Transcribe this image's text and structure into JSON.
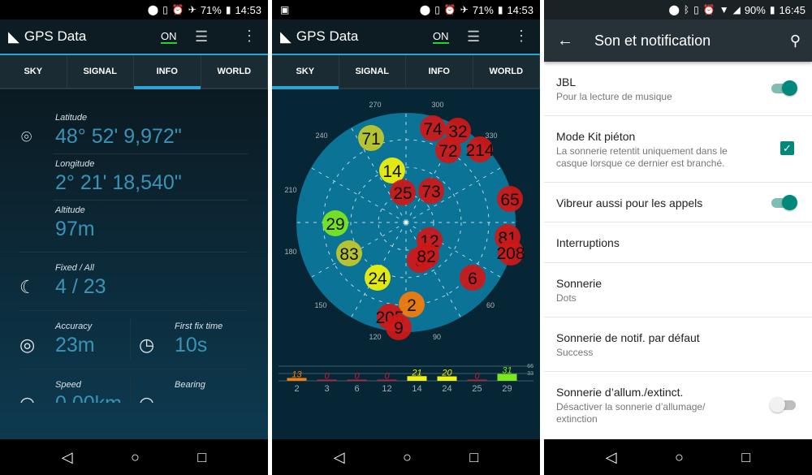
{
  "panel1": {
    "status": {
      "battery": "71%",
      "time": "14:53"
    },
    "app_title": "GPS Data",
    "on_label": "ON",
    "tabs": [
      "SKY",
      "SIGNAL",
      "INFO",
      "WORLD"
    ],
    "active_tab": "INFO",
    "info": {
      "latitude_label": "Latitude",
      "latitude": "48° 52' 9,972\"",
      "longitude_label": "Longitude",
      "longitude": "2° 21' 18,540\"",
      "altitude_label": "Altitude",
      "altitude": "97m",
      "fixed_label": "Fixed / All",
      "fixed": "4 / 23",
      "accuracy_label": "Accuracy",
      "accuracy": "23m",
      "first_fix_label": "First fix time",
      "first_fix": "10s",
      "speed_label": "Speed",
      "speed": "0,00km",
      "bearing_label": "Bearing"
    }
  },
  "panel2": {
    "status": {
      "battery": "71%",
      "time": "14:53"
    },
    "app_title": "GPS Data",
    "on_label": "ON",
    "tabs": [
      "SKY",
      "SIGNAL",
      "INFO",
      "WORLD"
    ],
    "active_tab": "SKY",
    "sky": {
      "degree_labels": [
        "270",
        "300",
        "330",
        "240",
        "210",
        "180",
        "150",
        "120",
        "90",
        "60"
      ],
      "satellites": [
        {
          "id": "71",
          "color": "#c3c92b"
        },
        {
          "id": "74",
          "color": "#d01818"
        },
        {
          "id": "32",
          "color": "#d01818"
        },
        {
          "id": "72",
          "color": "#d01818"
        },
        {
          "id": "214",
          "color": "#d01818"
        },
        {
          "id": "14",
          "color": "#f2f20a"
        },
        {
          "id": "25",
          "color": "#d01818"
        },
        {
          "id": "73",
          "color": "#d01818"
        },
        {
          "id": "65",
          "color": "#d01818"
        },
        {
          "id": "29",
          "color": "#7ce81c"
        },
        {
          "id": "81",
          "color": "#d01818"
        },
        {
          "id": "208",
          "color": "#d01818"
        },
        {
          "id": "83",
          "color": "#c3c92b"
        },
        {
          "id": "12",
          "color": "#d01818"
        },
        {
          "id": "8",
          "color": "#d01818"
        },
        {
          "id": "82",
          "color": "#d01818"
        },
        {
          "id": "6",
          "color": "#d01818"
        },
        {
          "id": "24",
          "color": "#f2f20a"
        },
        {
          "id": "2",
          "color": "#f57c0a"
        },
        {
          "id": "205",
          "color": "#d01818"
        },
        {
          "id": "9",
          "color": "#d01818"
        }
      ]
    },
    "chart_data": {
      "type": "bar",
      "categories": [
        "2",
        "3",
        "6",
        "12",
        "14",
        "24",
        "25",
        "29"
      ],
      "values": [
        13,
        0,
        0,
        0,
        21,
        20,
        0,
        31
      ],
      "colors": [
        "#f57c0a",
        "#c0203a",
        "#c0203a",
        "#c0203a",
        "#f2f20a",
        "#f2f20a",
        "#c0203a",
        "#7ce81c"
      ],
      "scale_labels": [
        "66",
        "33"
      ],
      "ylim": [
        0,
        66
      ]
    }
  },
  "panel3": {
    "status": {
      "battery": "90%",
      "time": "16:45"
    },
    "title": "Son et notification",
    "rows": [
      {
        "title": "JBL",
        "subtitle": "Pour la lecture de musique",
        "control": "toggle",
        "on": true
      },
      {
        "title": "Mode Kit piéton",
        "subtitle": "La sonnerie retentit uniquement dans le casque lorsque ce dernier est branché.",
        "control": "checkbox",
        "on": true
      },
      {
        "title": "Vibreur aussi pour les appels",
        "control": "toggle",
        "on": true
      },
      {
        "title": "Interruptions"
      },
      {
        "title": "Sonnerie",
        "subtitle": "Dots"
      },
      {
        "title": "Sonnerie de notif. par défaut",
        "subtitle": "Success"
      },
      {
        "title": "Sonnerie d’allum./extinct.",
        "subtitle": "Désactiver la sonnerie d’allumage/ extinction",
        "control": "toggle",
        "on": false
      }
    ]
  },
  "nav": {
    "back": "◁",
    "home": "○",
    "recents": "□"
  }
}
